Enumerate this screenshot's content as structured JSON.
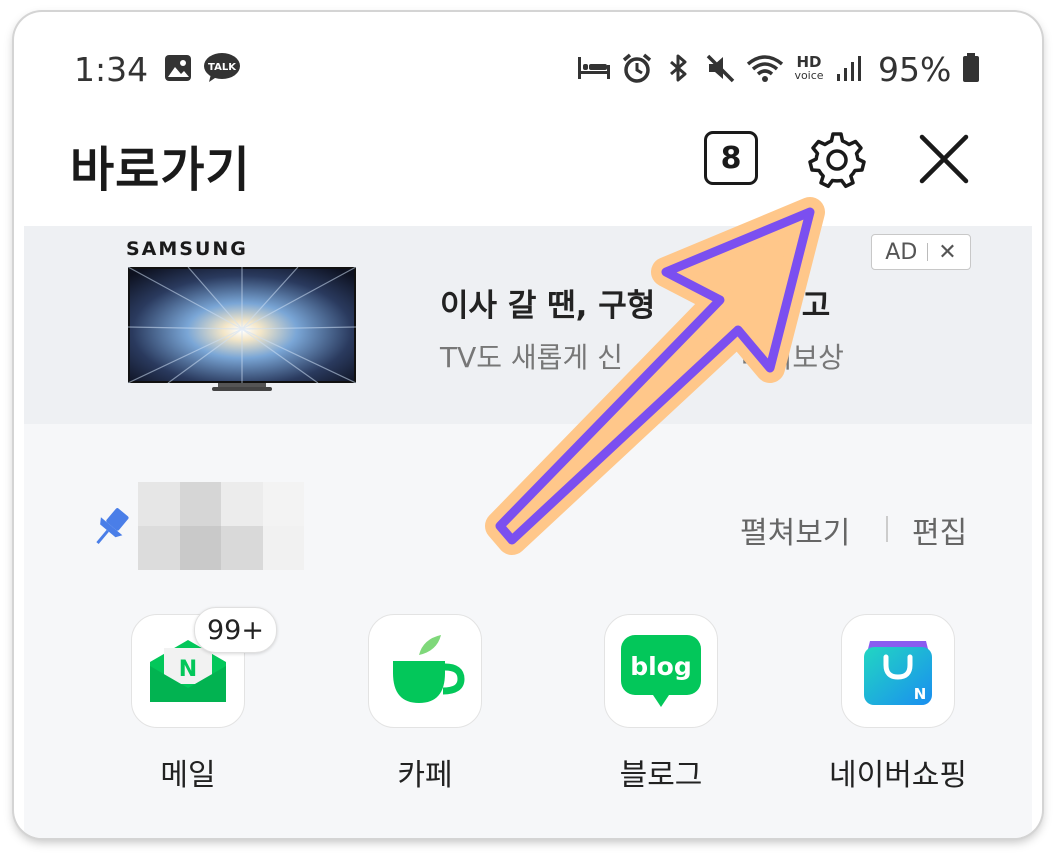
{
  "status_bar": {
    "time": "1:34",
    "talk_badge": "TALK",
    "hd_label": "HD",
    "voice_label": "voice",
    "battery": "95%"
  },
  "header": {
    "title": "바로가기",
    "tab_count": "8"
  },
  "ad": {
    "brand": "SAMSUNG",
    "headline": "이사 갈 땐, 구형",
    "headline_tail": "하고",
    "sub": "TV도 새롭게 신",
    "sub_tail": "바꿔보상",
    "tag": "AD",
    "close": "✕"
  },
  "shortcuts": {
    "expand_label": "펼쳐보기",
    "edit_label": "편집",
    "apps": [
      {
        "label": "메일",
        "badge": "99+"
      },
      {
        "label": "카페"
      },
      {
        "label": "블로그",
        "icon_text": "blog"
      },
      {
        "label": "네이버쇼핑"
      }
    ],
    "mail_icon_letter": "N",
    "shopping_icon_letter": "N"
  },
  "colors": {
    "naver_green": "#03c75a",
    "arrow_fill": "#ffc78a",
    "arrow_stroke": "#7b4ff0",
    "pin_blue": "#4a7ee8"
  }
}
